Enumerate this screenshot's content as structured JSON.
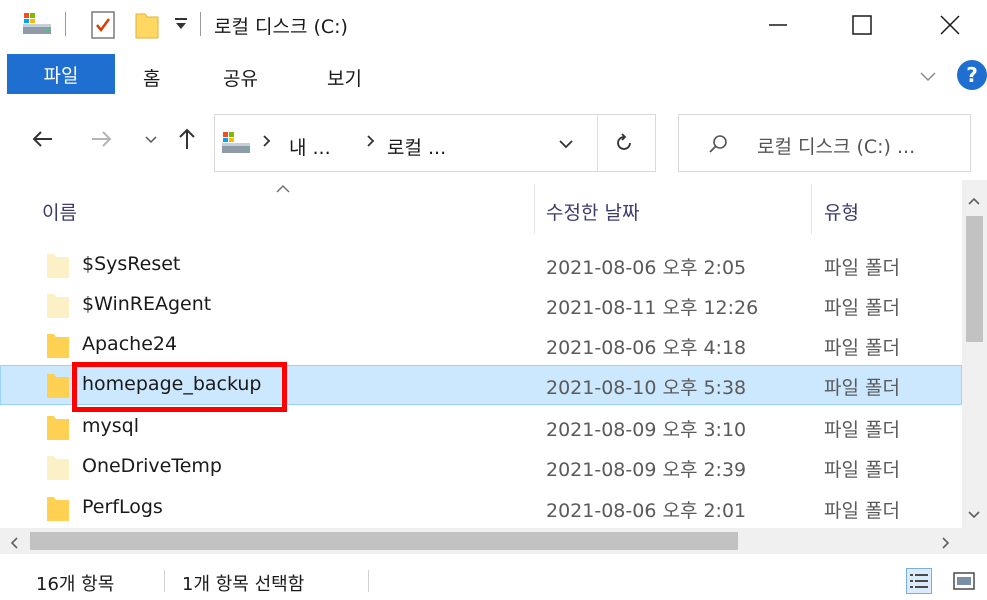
{
  "window": {
    "title": "로컬 디스크 (C:)",
    "colors": {
      "accent": "#1e6fd0",
      "selected_row": "#cce8ff",
      "highlight": "#ff0000"
    }
  },
  "quick_access": {
    "icons": [
      "drive-icon",
      "properties-check-icon",
      "new-folder-icon",
      "customize-dropdown-icon"
    ]
  },
  "ribbon": {
    "tabs": [
      "파일",
      "홈",
      "공유",
      "보기"
    ],
    "help_label": "?"
  },
  "navigation": {
    "breadcrumb": [
      "내 ...",
      "로컬 ..."
    ],
    "search_placeholder": "로컬 디스크 (C:) ..."
  },
  "columns": {
    "name": "이름",
    "modified": "수정한 날짜",
    "type": "유형"
  },
  "files": [
    {
      "name": "$SysReset",
      "date": "2021-08-06 오후 2:05",
      "type": "파일 폴더",
      "faded": true,
      "selected": false
    },
    {
      "name": "$WinREAgent",
      "date": "2021-08-11 오후 12:26",
      "type": "파일 폴더",
      "faded": true,
      "selected": false
    },
    {
      "name": "Apache24",
      "date": "2021-08-06 오후 4:18",
      "type": "파일 폴더",
      "faded": false,
      "selected": false
    },
    {
      "name": "homepage_backup",
      "date": "2021-08-10 오후 5:38",
      "type": "파일 폴더",
      "faded": false,
      "selected": true
    },
    {
      "name": "mysql",
      "date": "2021-08-09 오후 3:10",
      "type": "파일 폴더",
      "faded": false,
      "selected": false
    },
    {
      "name": "OneDriveTemp",
      "date": "2021-08-09 오후 2:39",
      "type": "파일 폴더",
      "faded": true,
      "selected": false
    },
    {
      "name": "PerfLogs",
      "date": "2021-08-06 오후 2:01",
      "type": "파일 폴더",
      "faded": false,
      "selected": false
    }
  ],
  "status": {
    "item_count": "16개 항목",
    "selection": "1개 항목 선택함"
  }
}
